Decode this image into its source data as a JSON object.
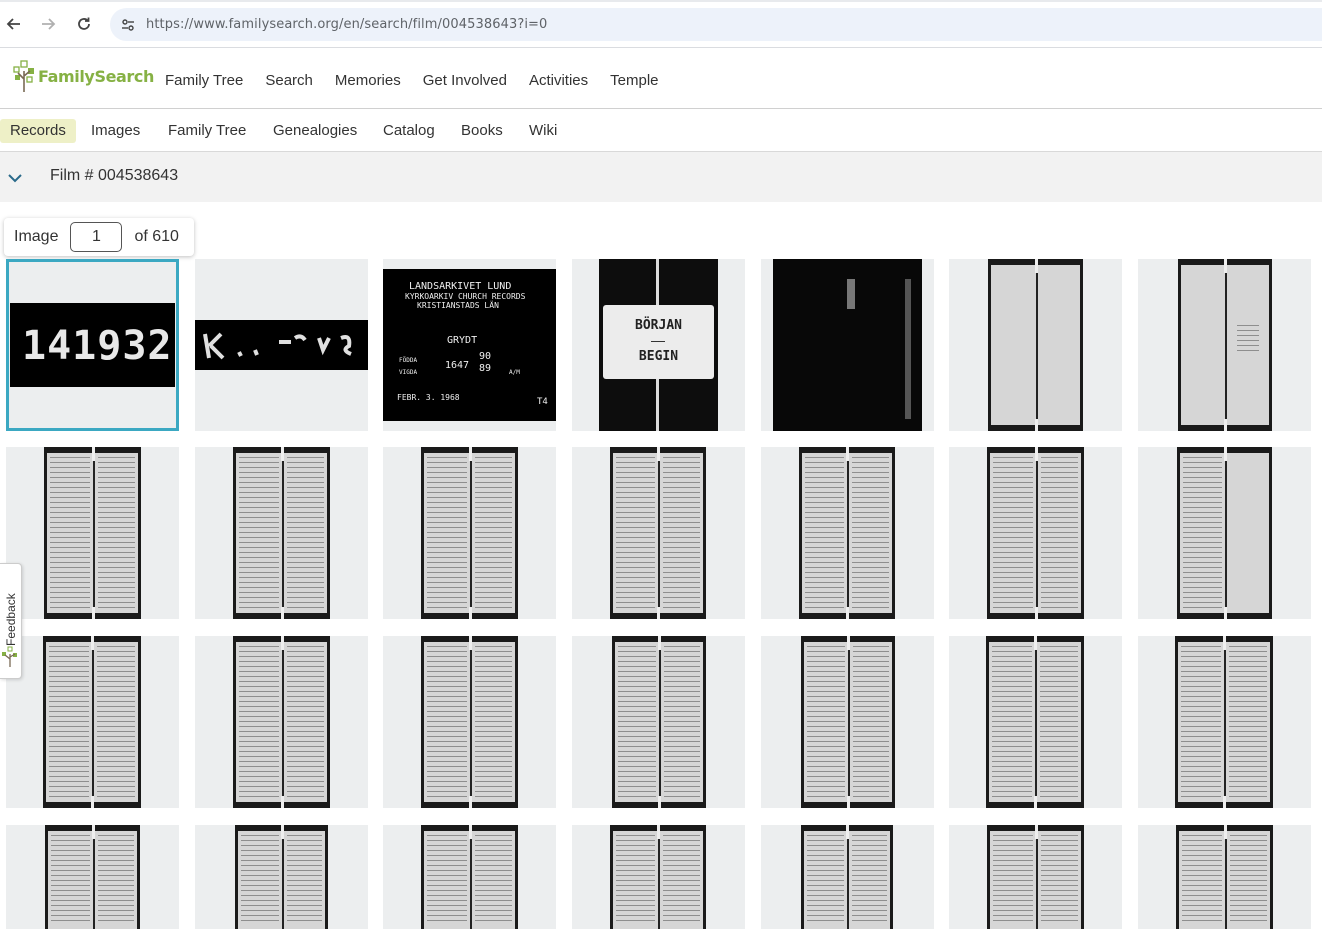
{
  "browser": {
    "url_host": "https://www.familysearch.org",
    "url_path": "/en/search/film/004538643?i=0"
  },
  "header": {
    "logo_text": "FamilySearch",
    "nav": [
      "Family Tree",
      "Search",
      "Memories",
      "Get Involved",
      "Activities",
      "Temple"
    ]
  },
  "subnav": {
    "tabs": [
      "Records",
      "Images",
      "Family Tree",
      "Genealogies",
      "Catalog",
      "Books",
      "Wiki"
    ],
    "active": "Records"
  },
  "film": {
    "title": "Film # 004538643"
  },
  "counter": {
    "label": "Image",
    "value": "1",
    "of_text": "of 610"
  },
  "thumbs": {
    "first_number": "141932",
    "sign1": {
      "line1": "LANDSARKIVET   LUND",
      "line2": "KYRKOARKIV  CHURCH  RECORDS",
      "line3": "KRISTIANSTADS  LÄN",
      "parish": "GRYDT",
      "label_left1": "FÖDDA",
      "label_left2": "VIGDA",
      "year_from": "1647",
      "year_to1": "90",
      "year_to2": "89",
      "label_right": "A/M",
      "date": "FEBR. 3.   1968",
      "code": "T4"
    },
    "sign2": {
      "line1": "BÖRJAN",
      "line2": "BEGIN"
    }
  },
  "feedback": {
    "label": "Feedback"
  }
}
